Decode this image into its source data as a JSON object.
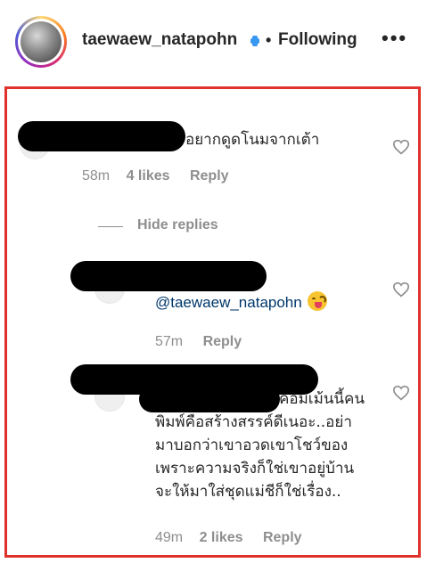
{
  "header": {
    "username": "taewaew_natapohn",
    "separator": "•",
    "follow_status": "Following",
    "more_label": "•••"
  },
  "comments": [
    {
      "text": "อยากดูดโนมจากเต้า",
      "time": "58m",
      "likes": "4 likes",
      "reply": "Reply"
    },
    {
      "mention": "@taewaew_natapohn",
      "time": "57m",
      "reply": "Reply"
    },
    {
      "lines": [
        "คอมเม้นนี้คน",
        "พิมพ์คือสร้างสรรค์ดีเนอะ..อย่า",
        "มาบอกว่าเขาอวดเขาโชว์ของ",
        "เพราะความจริงก็ใช่เขาอยู่บ้าน",
        "จะให้มาใส่ชุดแม่ชีก็ใช่เรื่อง.."
      ],
      "time": "49m",
      "likes": "2 likes",
      "reply": "Reply"
    }
  ],
  "replies_toggle": "Hide replies",
  "icons": {
    "heart": "heart-outline-icon",
    "emoji": "face-savoring-food-emoji",
    "verified": "verified-badge-icon"
  },
  "colors": {
    "highlight_border": "#e0322c",
    "meta_gray": "#8e8e8e",
    "mention_blue": "#00376b"
  }
}
